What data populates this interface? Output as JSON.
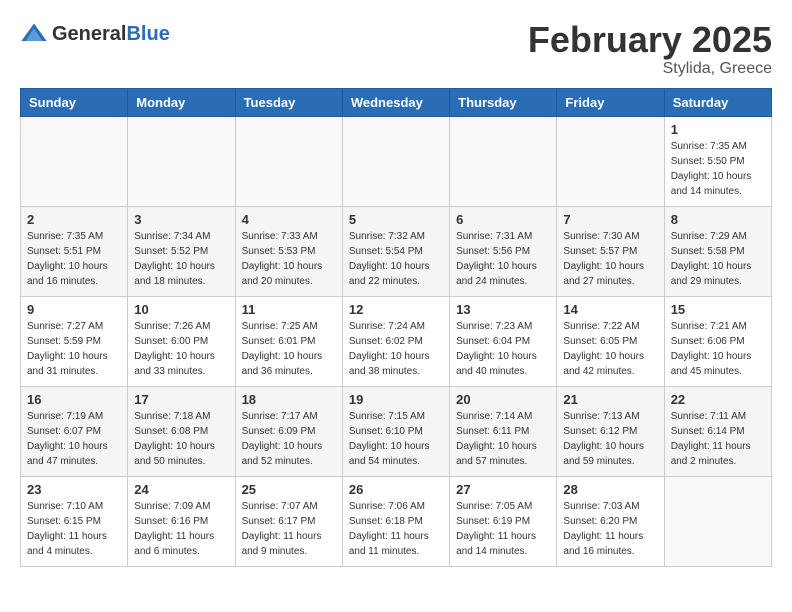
{
  "header": {
    "logo_general": "General",
    "logo_blue": "Blue",
    "month_title": "February 2025",
    "location": "Stylida, Greece"
  },
  "days_of_week": [
    "Sunday",
    "Monday",
    "Tuesday",
    "Wednesday",
    "Thursday",
    "Friday",
    "Saturday"
  ],
  "weeks": [
    [
      {
        "num": "",
        "info": ""
      },
      {
        "num": "",
        "info": ""
      },
      {
        "num": "",
        "info": ""
      },
      {
        "num": "",
        "info": ""
      },
      {
        "num": "",
        "info": ""
      },
      {
        "num": "",
        "info": ""
      },
      {
        "num": "1",
        "info": "Sunrise: 7:35 AM\nSunset: 5:50 PM\nDaylight: 10 hours and 14 minutes."
      }
    ],
    [
      {
        "num": "2",
        "info": "Sunrise: 7:35 AM\nSunset: 5:51 PM\nDaylight: 10 hours and 16 minutes."
      },
      {
        "num": "3",
        "info": "Sunrise: 7:34 AM\nSunset: 5:52 PM\nDaylight: 10 hours and 18 minutes."
      },
      {
        "num": "4",
        "info": "Sunrise: 7:33 AM\nSunset: 5:53 PM\nDaylight: 10 hours and 20 minutes."
      },
      {
        "num": "5",
        "info": "Sunrise: 7:32 AM\nSunset: 5:54 PM\nDaylight: 10 hours and 22 minutes."
      },
      {
        "num": "6",
        "info": "Sunrise: 7:31 AM\nSunset: 5:56 PM\nDaylight: 10 hours and 24 minutes."
      },
      {
        "num": "7",
        "info": "Sunrise: 7:30 AM\nSunset: 5:57 PM\nDaylight: 10 hours and 27 minutes."
      },
      {
        "num": "8",
        "info": "Sunrise: 7:29 AM\nSunset: 5:58 PM\nDaylight: 10 hours and 29 minutes."
      }
    ],
    [
      {
        "num": "9",
        "info": "Sunrise: 7:27 AM\nSunset: 5:59 PM\nDaylight: 10 hours and 31 minutes."
      },
      {
        "num": "10",
        "info": "Sunrise: 7:26 AM\nSunset: 6:00 PM\nDaylight: 10 hours and 33 minutes."
      },
      {
        "num": "11",
        "info": "Sunrise: 7:25 AM\nSunset: 6:01 PM\nDaylight: 10 hours and 36 minutes."
      },
      {
        "num": "12",
        "info": "Sunrise: 7:24 AM\nSunset: 6:02 PM\nDaylight: 10 hours and 38 minutes."
      },
      {
        "num": "13",
        "info": "Sunrise: 7:23 AM\nSunset: 6:04 PM\nDaylight: 10 hours and 40 minutes."
      },
      {
        "num": "14",
        "info": "Sunrise: 7:22 AM\nSunset: 6:05 PM\nDaylight: 10 hours and 42 minutes."
      },
      {
        "num": "15",
        "info": "Sunrise: 7:21 AM\nSunset: 6:06 PM\nDaylight: 10 hours and 45 minutes."
      }
    ],
    [
      {
        "num": "16",
        "info": "Sunrise: 7:19 AM\nSunset: 6:07 PM\nDaylight: 10 hours and 47 minutes."
      },
      {
        "num": "17",
        "info": "Sunrise: 7:18 AM\nSunset: 6:08 PM\nDaylight: 10 hours and 50 minutes."
      },
      {
        "num": "18",
        "info": "Sunrise: 7:17 AM\nSunset: 6:09 PM\nDaylight: 10 hours and 52 minutes."
      },
      {
        "num": "19",
        "info": "Sunrise: 7:15 AM\nSunset: 6:10 PM\nDaylight: 10 hours and 54 minutes."
      },
      {
        "num": "20",
        "info": "Sunrise: 7:14 AM\nSunset: 6:11 PM\nDaylight: 10 hours and 57 minutes."
      },
      {
        "num": "21",
        "info": "Sunrise: 7:13 AM\nSunset: 6:12 PM\nDaylight: 10 hours and 59 minutes."
      },
      {
        "num": "22",
        "info": "Sunrise: 7:11 AM\nSunset: 6:14 PM\nDaylight: 11 hours and 2 minutes."
      }
    ],
    [
      {
        "num": "23",
        "info": "Sunrise: 7:10 AM\nSunset: 6:15 PM\nDaylight: 11 hours and 4 minutes."
      },
      {
        "num": "24",
        "info": "Sunrise: 7:09 AM\nSunset: 6:16 PM\nDaylight: 11 hours and 6 minutes."
      },
      {
        "num": "25",
        "info": "Sunrise: 7:07 AM\nSunset: 6:17 PM\nDaylight: 11 hours and 9 minutes."
      },
      {
        "num": "26",
        "info": "Sunrise: 7:06 AM\nSunset: 6:18 PM\nDaylight: 11 hours and 11 minutes."
      },
      {
        "num": "27",
        "info": "Sunrise: 7:05 AM\nSunset: 6:19 PM\nDaylight: 11 hours and 14 minutes."
      },
      {
        "num": "28",
        "info": "Sunrise: 7:03 AM\nSunset: 6:20 PM\nDaylight: 11 hours and 16 minutes."
      },
      {
        "num": "",
        "info": ""
      }
    ]
  ]
}
